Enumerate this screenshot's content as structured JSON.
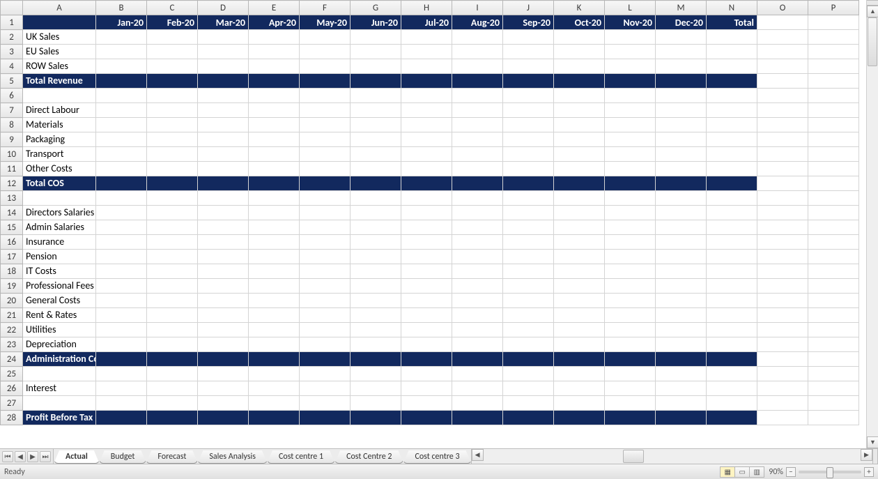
{
  "columns": [
    "A",
    "B",
    "C",
    "D",
    "E",
    "F",
    "G",
    "H",
    "I",
    "J",
    "K",
    "L",
    "M",
    "N",
    "O",
    "P"
  ],
  "header": {
    "months": [
      "Jan-20",
      "Feb-20",
      "Mar-20",
      "Apr-20",
      "May-20",
      "Jun-20",
      "Jul-20",
      "Aug-20",
      "Sep-20",
      "Oct-20",
      "Nov-20",
      "Dec-20"
    ],
    "total": "Total"
  },
  "rows": [
    {
      "n": 1,
      "type": "header"
    },
    {
      "n": 2,
      "type": "label",
      "text": "UK Sales"
    },
    {
      "n": 3,
      "type": "label",
      "text": "EU Sales"
    },
    {
      "n": 4,
      "type": "label",
      "text": "ROW Sales"
    },
    {
      "n": 5,
      "type": "navy",
      "text": "Total Revenue"
    },
    {
      "n": 6,
      "type": "blank"
    },
    {
      "n": 7,
      "type": "label",
      "text": "Direct Labour"
    },
    {
      "n": 8,
      "type": "label",
      "text": "Materials"
    },
    {
      "n": 9,
      "type": "label",
      "text": "Packaging"
    },
    {
      "n": 10,
      "type": "label",
      "text": "Transport"
    },
    {
      "n": 11,
      "type": "label",
      "text": "Other Costs"
    },
    {
      "n": 12,
      "type": "navy",
      "text": "Total COS"
    },
    {
      "n": 13,
      "type": "blank"
    },
    {
      "n": 14,
      "type": "label",
      "text": "Directors Salaries"
    },
    {
      "n": 15,
      "type": "label",
      "text": "Admin Salaries"
    },
    {
      "n": 16,
      "type": "label",
      "text": "Insurance"
    },
    {
      "n": 17,
      "type": "label",
      "text": "Pension"
    },
    {
      "n": 18,
      "type": "label",
      "text": "IT Costs"
    },
    {
      "n": 19,
      "type": "label",
      "text": "Professional Fees"
    },
    {
      "n": 20,
      "type": "label",
      "text": "General Costs"
    },
    {
      "n": 21,
      "type": "label",
      "text": "Rent & Rates"
    },
    {
      "n": 22,
      "type": "label",
      "text": "Utilities"
    },
    {
      "n": 23,
      "type": "label",
      "text": "Depreciation"
    },
    {
      "n": 24,
      "type": "navy",
      "text": "Administration Costs"
    },
    {
      "n": 25,
      "type": "blank"
    },
    {
      "n": 26,
      "type": "label",
      "text": "Interest"
    },
    {
      "n": 27,
      "type": "blank"
    },
    {
      "n": 28,
      "type": "navy",
      "text": "Profit Before Tax"
    }
  ],
  "tabs": {
    "nav": {
      "first": "⏮",
      "prev": "◀",
      "next": "▶",
      "last": "⏭"
    },
    "items": [
      {
        "label": "Actual",
        "active": true
      },
      {
        "label": "Budget",
        "active": false
      },
      {
        "label": "Forecast",
        "active": false
      },
      {
        "label": "Sales Analysis",
        "active": false
      },
      {
        "label": "Cost centre 1",
        "active": false
      },
      {
        "label": "Cost Centre 2",
        "active": false
      },
      {
        "label": "Cost centre 3",
        "active": false
      }
    ]
  },
  "status": {
    "ready": "Ready",
    "zoom": "90%"
  }
}
